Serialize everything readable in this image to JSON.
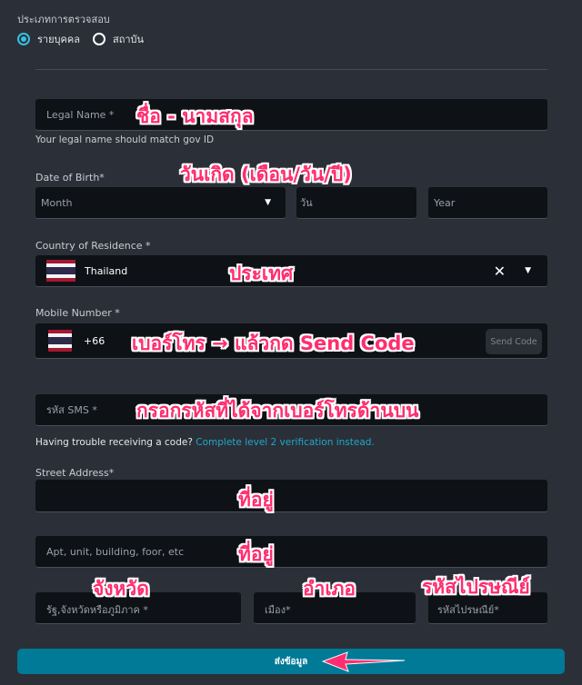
{
  "verification_type": {
    "label": "ประเภทการตรวจสอบ",
    "options": [
      {
        "label": "รายบุคคล",
        "selected": true
      },
      {
        "label": "สถาบัน",
        "selected": false
      }
    ]
  },
  "legal_name": {
    "placeholder": "Legal Name *",
    "helper": "Your legal name should match gov ID",
    "annotation": "ชื่อ - นามสกุล"
  },
  "dob": {
    "label": "Date of Birth*",
    "month": "Month",
    "day": "วัน",
    "year": "Year",
    "annotation": "วันเกิด (เดือน/วัน/ปี)"
  },
  "country": {
    "label": "Country of Residence *",
    "value": "Thailand",
    "annotation": "ประเทศ"
  },
  "mobile": {
    "label": "Mobile Number *",
    "code": "+66",
    "send_code": "Send Code",
    "annotation": "เบอร์โทร → แล้วกด Send Code"
  },
  "sms": {
    "placeholder": "รหัส SMS *",
    "annotation": "กรอกรหัสที่ได้จากเบอร์โทรด้านบน",
    "trouble": "Having trouble receiving a code?",
    "link": "Complete level 2 verification instead."
  },
  "street": {
    "label": "Street Address*",
    "annotation": "ที่อยู่"
  },
  "apt": {
    "placeholder": "Apt, unit, building, foor, etc",
    "annotation": "ที่อยู่"
  },
  "state": {
    "placeholder": "รัฐ,จังหวัดหรือภูมิภาค *",
    "annotation": "จังหวัด"
  },
  "city": {
    "placeholder": "เมือง*",
    "annotation": "อำเภอ"
  },
  "postal": {
    "placeholder": "รหัสไปรษณีย์*",
    "annotation": "รหัสไปรษณีย์"
  },
  "submit": "ส่งข้อมูล",
  "colors": {
    "accent": "#007a96",
    "annotation": "#ff2d6f",
    "link": "#1fa9c6"
  }
}
